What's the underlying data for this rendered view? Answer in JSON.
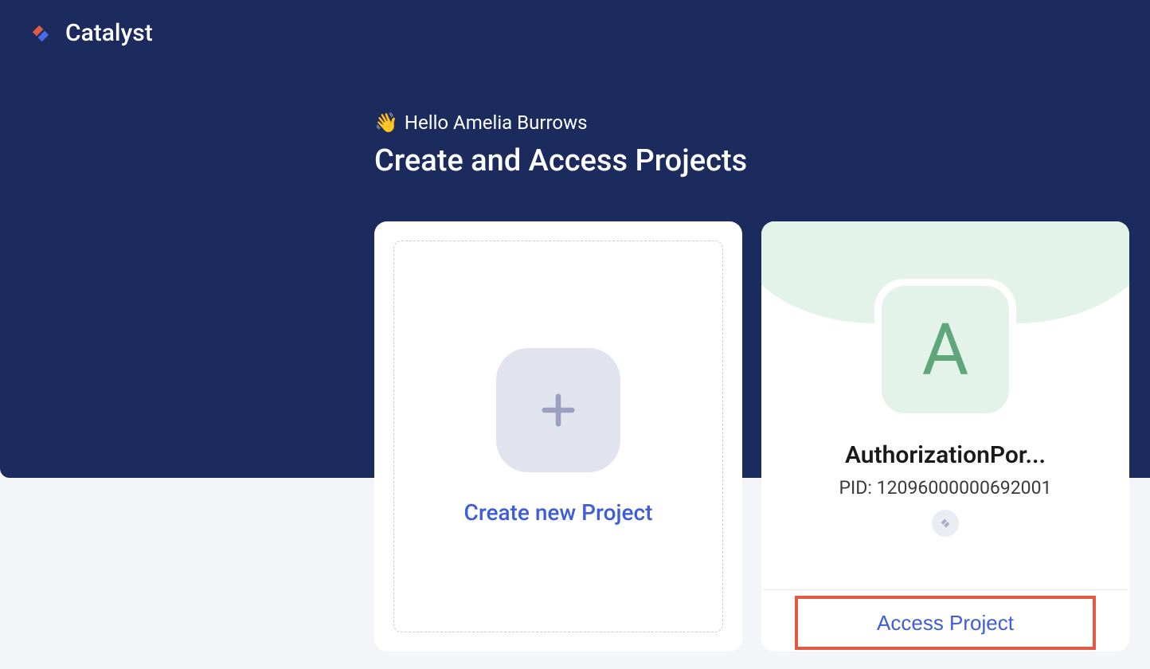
{
  "brand": {
    "name": "Catalyst"
  },
  "greeting": {
    "emoji": "👋",
    "text": "Hello Amelia Burrows"
  },
  "page": {
    "title": "Create and Access Projects"
  },
  "create_card": {
    "label": "Create new Project"
  },
  "project": {
    "avatar_letter": "A",
    "name": "AuthorizationPor...",
    "pid_label": "PID: 12096000000692001",
    "access_button_label": "Access Project"
  },
  "colors": {
    "hero_bg": "#1c2b5d",
    "link_blue": "#3f5cd9",
    "avatar_green_bg": "#e4f3e9",
    "avatar_green_text": "#5fa67a",
    "highlight_border": "#e15a42"
  }
}
